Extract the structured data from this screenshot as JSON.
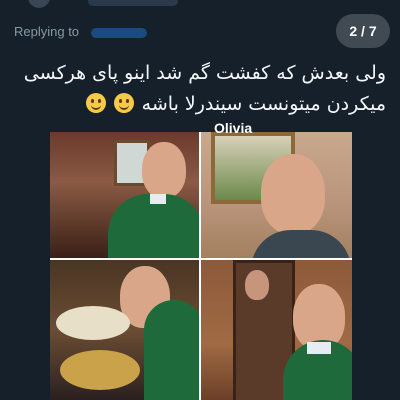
{
  "header": {
    "reply_label": "Replying to",
    "counter": "2 / 7"
  },
  "tweet": {
    "line1": "ولی بعدش که کفشت گم شد اینو پای هرکسی",
    "line2": "میکردن میتونست سیندرلا باشه"
  },
  "media": {
    "watermark": "Olivia",
    "photos": [
      {
        "id": "p1",
        "description_icon": "man-in-kitchen"
      },
      {
        "id": "p2",
        "description_icon": "man-closeup-painting"
      },
      {
        "id": "p3",
        "description_icon": "man-with-tea-set"
      },
      {
        "id": "p4",
        "description_icon": "man-by-mirror"
      }
    ]
  },
  "colors": {
    "background": "#15202b",
    "text": "#f5f8fa",
    "secondary_text": "#8899a6",
    "sweater": "#1f6a3a"
  }
}
